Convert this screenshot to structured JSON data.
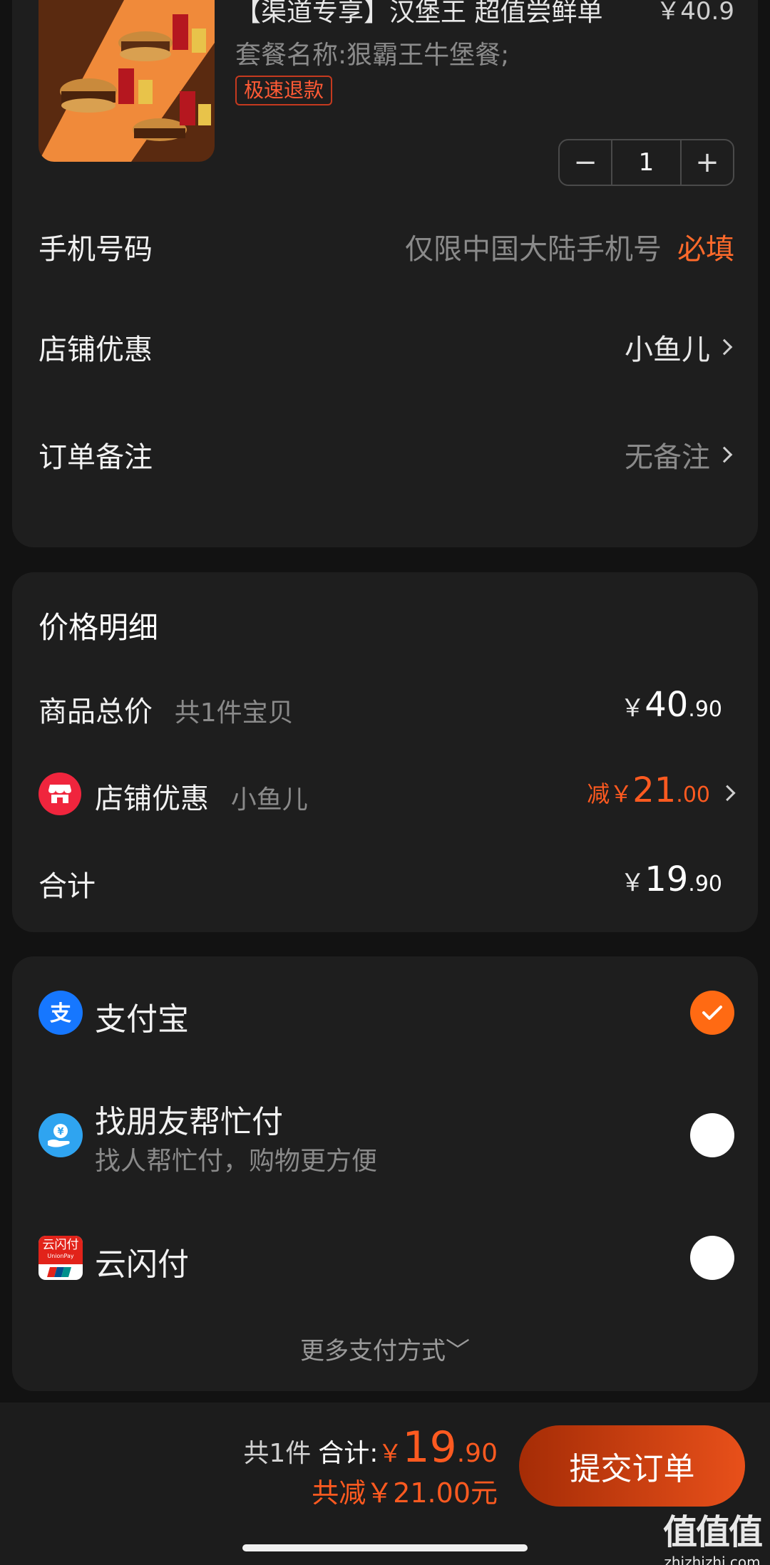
{
  "product": {
    "title": "【渠道专享】汉堡王 超值尝鲜单",
    "price": "￥40.9",
    "spec": "套餐名称:狠霸王牛堡餐;",
    "tag": "极速退款",
    "quantity": "1",
    "minus": "−",
    "plus": "+"
  },
  "form": {
    "phone_label": "手机号码",
    "phone_placeholder": "仅限中国大陆手机号",
    "phone_required": "必填",
    "store_coupon_label": "店铺优惠",
    "store_coupon_value": "小鱼儿",
    "note_label": "订单备注",
    "note_value": "无备注"
  },
  "price_detail": {
    "title": "价格明细",
    "goods_label": "商品总价",
    "goods_count": "共1件宝贝",
    "goods_yen": "￥",
    "goods_int": "40",
    "goods_dec": ".90",
    "store_label": "店铺优惠",
    "store_name": "小鱼儿",
    "store_prefix": "减￥",
    "store_int": "21",
    "store_dec": ".00",
    "total_label": "合计",
    "total_yen": "￥",
    "total_int": "19",
    "total_dec": ".90"
  },
  "payment": {
    "alipay_label": "支付宝",
    "friend_label": "找朋友帮忙付",
    "friend_sub": "找人帮忙付，购物更方便",
    "unionpay_label": "云闪付",
    "unionpay_icon_text": "云闪付",
    "unionpay_icon_sub": "UnionPay",
    "more": "更多支付方式﹀",
    "selected": "alipay"
  },
  "bottom": {
    "count": "共1件",
    "total_label": "合计:",
    "total_yen": "￥",
    "total_int": "19",
    "total_dec": ".90",
    "saved": "共减￥21.00元",
    "submit": "提交订单"
  },
  "watermark": {
    "big": "值值值",
    "small": "zhizhizhi.com"
  },
  "colors": {
    "accent": "#ff6a13",
    "discount": "#ff5a20",
    "card": "#1e1e1e",
    "background": "#121212"
  }
}
